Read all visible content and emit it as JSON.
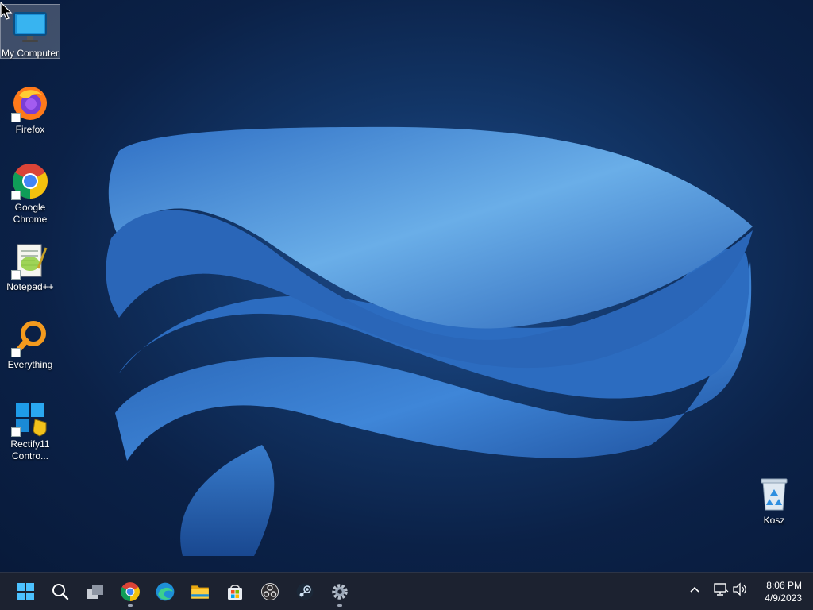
{
  "desktop": {
    "icons": [
      {
        "id": "my-computer",
        "label": "My Computer",
        "selected": true
      },
      {
        "id": "firefox",
        "label": "Firefox"
      },
      {
        "id": "google-chrome",
        "label": "Google Chrome"
      },
      {
        "id": "notepadpp",
        "label": "Notepad++"
      },
      {
        "id": "everything",
        "label": "Everything"
      },
      {
        "id": "rectify11",
        "label": "Rectify11 Contro..."
      },
      {
        "id": "recycle-bin",
        "label": "Kosz"
      }
    ]
  },
  "taskbar": {
    "apps": [
      {
        "name": "start",
        "icon": "windows-start-icon"
      },
      {
        "name": "search",
        "icon": "search-icon"
      },
      {
        "name": "task-view",
        "icon": "task-view-icon"
      },
      {
        "name": "chrome",
        "icon": "chrome-icon",
        "running": true
      },
      {
        "name": "edge",
        "icon": "edge-icon"
      },
      {
        "name": "file-explorer",
        "icon": "folder-icon"
      },
      {
        "name": "microsoft-store",
        "icon": "store-icon"
      },
      {
        "name": "obs",
        "icon": "obs-icon"
      },
      {
        "name": "steam",
        "icon": "steam-icon"
      },
      {
        "name": "settings",
        "icon": "gear-icon",
        "running": true
      }
    ],
    "tray": {
      "overflow_icon": "chevron-up-icon",
      "network_icon": "network-icon",
      "volume_icon": "speaker-icon"
    },
    "clock": {
      "time": "8:06 PM",
      "date": "4/9/2023"
    }
  },
  "colors": {
    "desktop_dark": "#081a3a",
    "bloom_blue": "#3f86d8",
    "taskbar_bg": "#1c2230"
  }
}
